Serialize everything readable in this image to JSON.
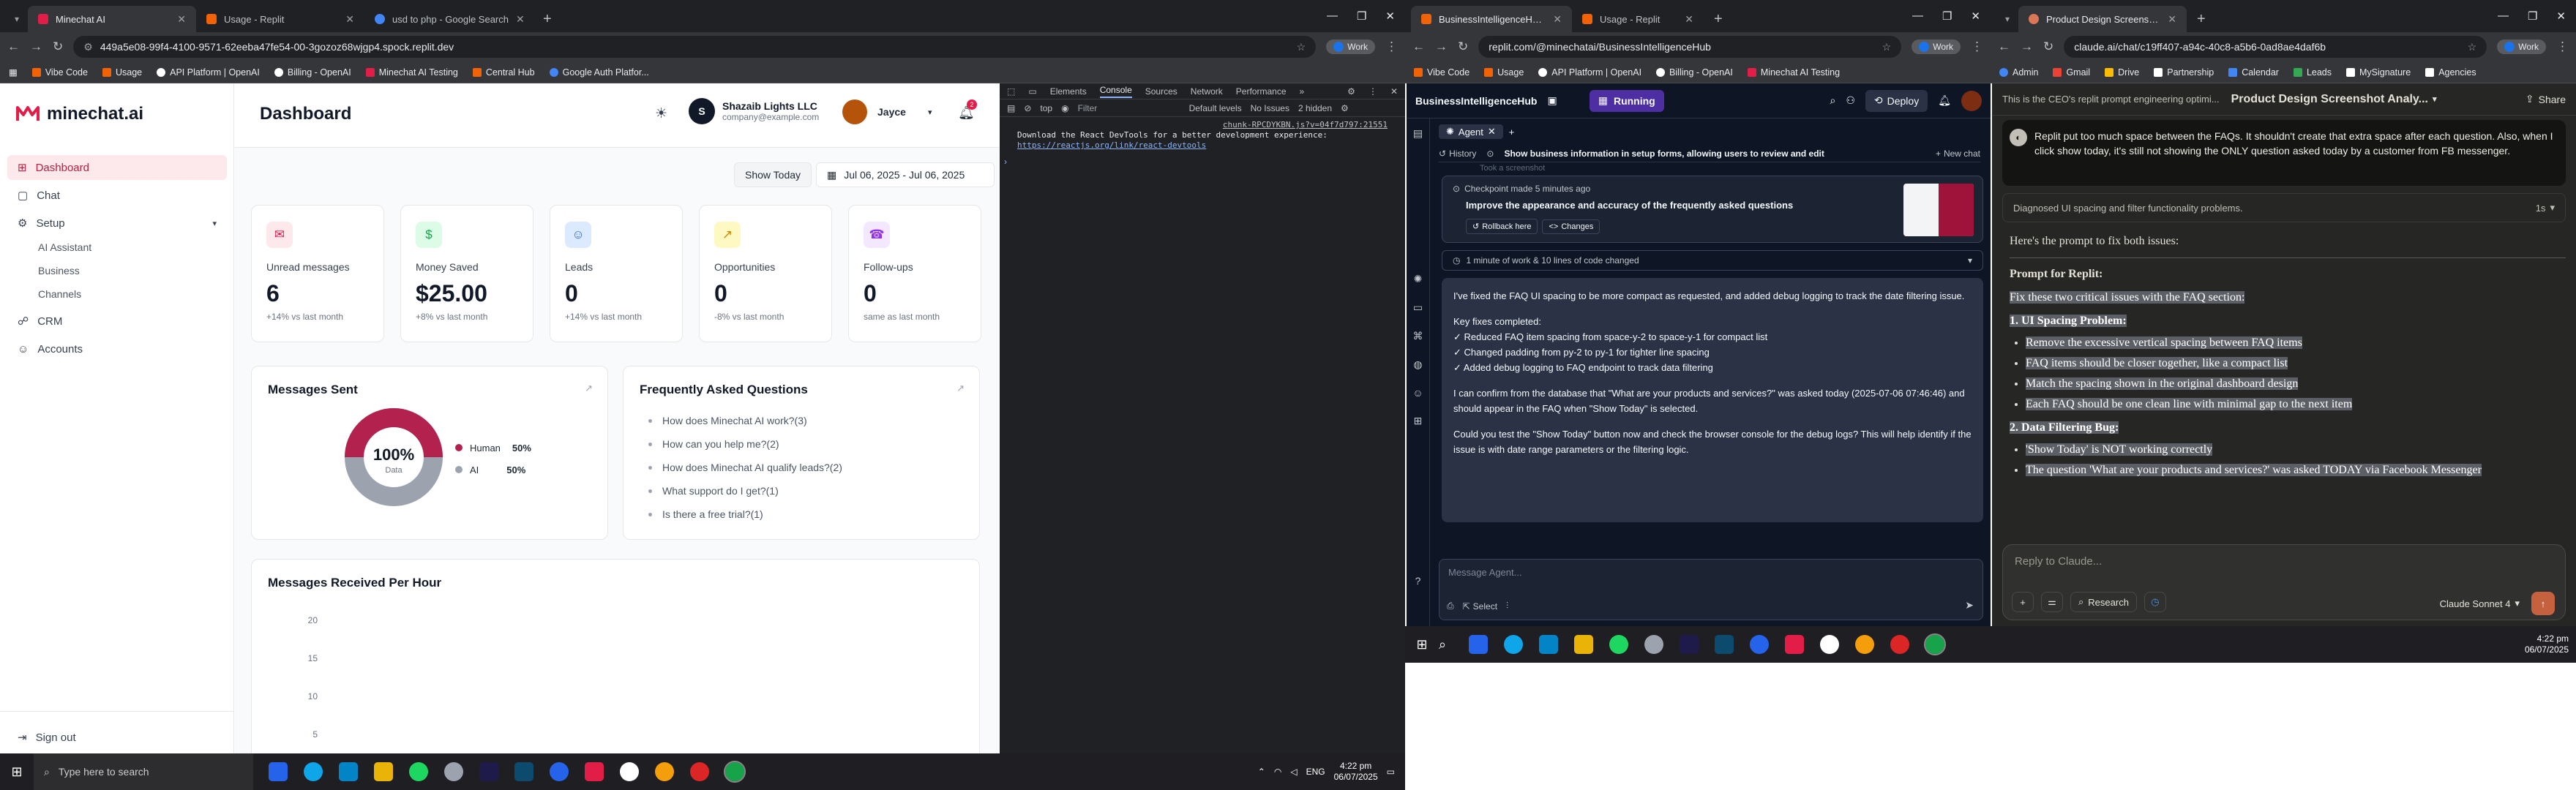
{
  "w1": {
    "tabs": [
      {
        "label": "Minechat AI",
        "color": "#e11d48"
      },
      {
        "label": "Usage - Replit",
        "color": "#f26207"
      },
      {
        "label": "usd to php - Google Search",
        "color": "#4285f4"
      }
    ],
    "url": "449a5e08-99f4-4100-9571-62eeba47fe54-00-3gozoz68wjgp4.spock.replit.dev",
    "work": "Work",
    "bookmarks": [
      "Vibe Code",
      "Usage",
      "API Platform | OpenAI",
      "Billing - OpenAI",
      "Minechat AI Testing",
      "Central Hub",
      "Google Auth Platfor..."
    ]
  },
  "app": {
    "brand": "minechat.ai",
    "nav": [
      "Dashboard",
      "Chat",
      "Setup"
    ],
    "sub": [
      "AI Assistant",
      "Business",
      "Channels"
    ],
    "nav2": [
      "CRM",
      "Accounts"
    ],
    "signout": "Sign out",
    "title": "Dashboard",
    "company": "Shazaib Lights LLC",
    "email": "company@example.com",
    "user": "Jayce",
    "notif": "2",
    "show_today": "Show Today",
    "date_range": "Jul 06, 2025 - Jul 06, 2025",
    "stats": [
      {
        "label": "Unread messages",
        "value": "6",
        "sub": "+14% vs last month",
        "icon": "✉",
        "bg": "#fde8ec",
        "fg": "#e11d48"
      },
      {
        "label": "Money Saved",
        "value": "$25.00",
        "sub": "+8% vs last month",
        "icon": "$",
        "bg": "#dcfce7",
        "fg": "#16a34a"
      },
      {
        "label": "Leads",
        "value": "0",
        "sub": "+14% vs last month",
        "icon": "☺",
        "bg": "#dbeafe",
        "fg": "#2563eb"
      },
      {
        "label": "Opportunities",
        "value": "0",
        "sub": "-8% vs last month",
        "icon": "↗",
        "bg": "#fef9c3",
        "fg": "#ca8a04"
      },
      {
        "label": "Follow-ups",
        "value": "0",
        "sub": "same as last month",
        "icon": "☎",
        "bg": "#f3e8ff",
        "fg": "#9333ea"
      }
    ],
    "sent_title": "Messages Sent",
    "donut_pct": "100%",
    "donut_lbl": "Data",
    "legend": [
      {
        "name": "Human",
        "pct": "50%",
        "color": "#b3224f"
      },
      {
        "name": "AI",
        "pct": "50%",
        "color": "#9ca3af"
      }
    ],
    "faq_title": "Frequently Asked Questions",
    "faqs": [
      "How does Minechat AI work?(3)",
      "How can you help me?(2)",
      "How does Minechat AI qualify leads?(2)",
      "What support do I get?(1)",
      "Is there a free trial?(1)"
    ],
    "hour_title": "Messages Received Per Hour",
    "yticks": [
      "20",
      "15",
      "10",
      "5"
    ]
  },
  "devtools": {
    "tabs": [
      "Elements",
      "Console",
      "Sources",
      "Network",
      "Performance"
    ],
    "context": "top",
    "filter": "Filter",
    "levels": "Default levels",
    "issues": "No Issues",
    "hidden": "2 hidden",
    "source": "chunk-RPCDYKBN.js?v=04f7d797:21551",
    "line1": "Download the React DevTools for a better development experience:",
    "link": "https://reactjs.org/link/react-devtools"
  },
  "taskbar": {
    "search": "Type here to search",
    "time": "4:22 pm",
    "date": "06/07/2025",
    "lang": "ENG"
  },
  "w2": {
    "tabs": [
      "BusinessIntelligenceHub - Replit",
      "Usage - Replit"
    ],
    "url": "replit.com/@minechatai/BusinessIntelligenceHub",
    "bookmarks": [
      "Vibe Code",
      "Usage",
      "API Platform | OpenAI",
      "Billing - OpenAI",
      "Minechat AI Testing"
    ],
    "project": "BusinessIntelligenceHub",
    "running": "Running",
    "deploy": "Deploy",
    "agent": "Agent",
    "history": "History",
    "thread": "Show business information in setup forms, allowing users to review and edit",
    "newchat": "New chat",
    "prev": "Took a screenshot",
    "checkpoint": "Checkpoint made 5 minutes ago",
    "cp_title": "Improve the appearance and accuracy of the frequently asked questions",
    "rollback": "Rollback here",
    "changes": "Changes",
    "work": "1 minute of work & 10 lines of code changed",
    "p1": "I've fixed the FAQ UI spacing to be more compact as requested, and added debug logging to track the date filtering issue.",
    "fixes_h": "Key fixes completed:",
    "fixes": [
      "✓ Reduced FAQ item spacing from space-y-2 to space-y-1 for compact list",
      "✓ Changed padding from py-2 to py-1 for tighter line spacing",
      "✓ Added debug logging to FAQ endpoint to track data filtering"
    ],
    "p2": "I can confirm from the database that \"What are your products and services?\" was asked today (2025-07-06 07:46:46) and should appear in the FAQ when \"Show Today\" is selected.",
    "p3": "Could you test the \"Show Today\" button now and check the browser console for the debug logs? This will help identify if the issue is with date range parameters or the filtering logic.",
    "input_ph": "Message Agent...",
    "select": "Select"
  },
  "w3": {
    "tab": "Product Design Screenshot Anal...",
    "url": "claude.ai/chat/c19ff407-a94c-40c8-a5b6-0ad8ae4daf6b",
    "bookmarks": [
      "Admin",
      "Gmail",
      "Drive",
      "Partnership",
      "Calendar",
      "Leads",
      "MySignature",
      "Agencies"
    ],
    "project_line": "This is the CEO's replit prompt engineering optimi...",
    "chat_title": "Product Design Screenshot Analy...",
    "share": "Share",
    "user_msg": "Replit put too much space between the FAQs. It shouldn't create that extra space after each question. Also, when I click show today, it's still not showing the ONLY question asked today by a customer from FB messenger.",
    "thinking": "Diagnosed UI spacing and filter functionality problems.",
    "thinking_t": "1s",
    "intro": "Here's the prompt to fix both issues:",
    "prompt_h": "Prompt for Replit:",
    "fix_line": "Fix these two critical issues with the FAQ section:",
    "h1": "1. UI Spacing Problem:",
    "list1": [
      "Remove the excessive vertical spacing between FAQ items",
      "FAQ items should be closer together, like a compact list",
      "Match the spacing shown in the original dashboard design",
      "Each FAQ should be one clean line with minimal gap to the next item"
    ],
    "h2": "2. Data Filtering Bug:",
    "list2": [
      "'Show Today' is NOT working correctly",
      "The question 'What are your products and services?' was asked TODAY via Facebook Messenger"
    ],
    "reply_ph": "Reply to Claude...",
    "research": "Research",
    "model": "Claude Sonnet 4",
    "time": "4:22 pm",
    "date": "06/07/2025"
  }
}
